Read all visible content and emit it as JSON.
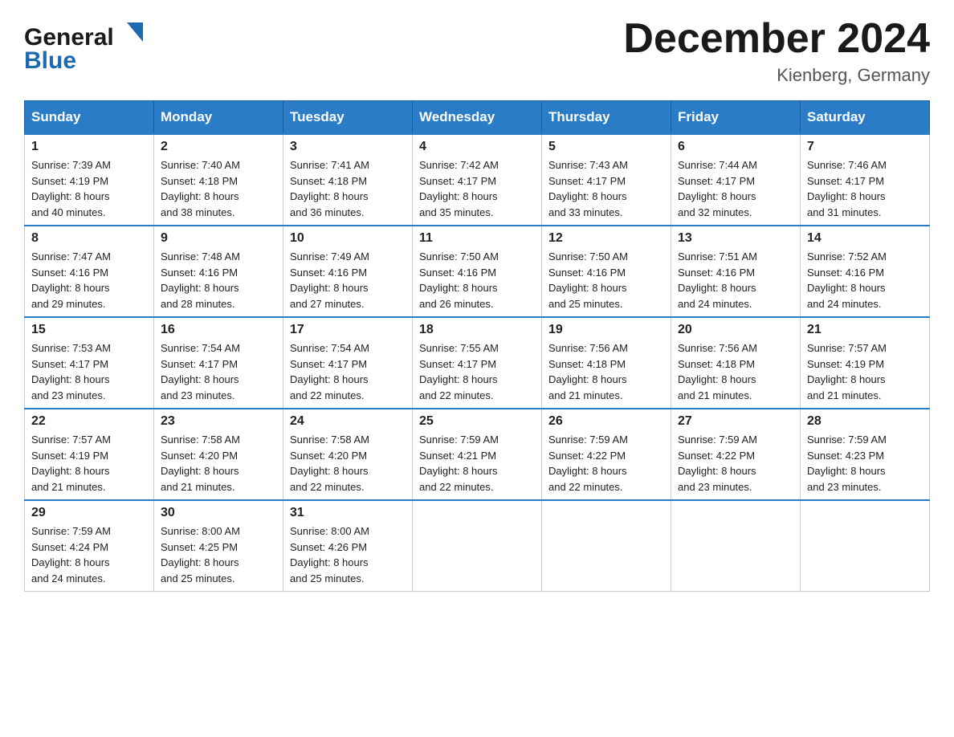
{
  "logo": {
    "text_general": "General",
    "text_blue": "Blue",
    "arrow_color": "#1e6ab0"
  },
  "header": {
    "title": "December 2024",
    "subtitle": "Kienberg, Germany"
  },
  "weekdays": [
    "Sunday",
    "Monday",
    "Tuesday",
    "Wednesday",
    "Thursday",
    "Friday",
    "Saturday"
  ],
  "weeks": [
    [
      {
        "day": "1",
        "sunrise": "7:39 AM",
        "sunset": "4:19 PM",
        "daylight": "8 hours and 40 minutes."
      },
      {
        "day": "2",
        "sunrise": "7:40 AM",
        "sunset": "4:18 PM",
        "daylight": "8 hours and 38 minutes."
      },
      {
        "day": "3",
        "sunrise": "7:41 AM",
        "sunset": "4:18 PM",
        "daylight": "8 hours and 36 minutes."
      },
      {
        "day": "4",
        "sunrise": "7:42 AM",
        "sunset": "4:17 PM",
        "daylight": "8 hours and 35 minutes."
      },
      {
        "day": "5",
        "sunrise": "7:43 AM",
        "sunset": "4:17 PM",
        "daylight": "8 hours and 33 minutes."
      },
      {
        "day": "6",
        "sunrise": "7:44 AM",
        "sunset": "4:17 PM",
        "daylight": "8 hours and 32 minutes."
      },
      {
        "day": "7",
        "sunrise": "7:46 AM",
        "sunset": "4:17 PM",
        "daylight": "8 hours and 31 minutes."
      }
    ],
    [
      {
        "day": "8",
        "sunrise": "7:47 AM",
        "sunset": "4:16 PM",
        "daylight": "8 hours and 29 minutes."
      },
      {
        "day": "9",
        "sunrise": "7:48 AM",
        "sunset": "4:16 PM",
        "daylight": "8 hours and 28 minutes."
      },
      {
        "day": "10",
        "sunrise": "7:49 AM",
        "sunset": "4:16 PM",
        "daylight": "8 hours and 27 minutes."
      },
      {
        "day": "11",
        "sunrise": "7:50 AM",
        "sunset": "4:16 PM",
        "daylight": "8 hours and 26 minutes."
      },
      {
        "day": "12",
        "sunrise": "7:50 AM",
        "sunset": "4:16 PM",
        "daylight": "8 hours and 25 minutes."
      },
      {
        "day": "13",
        "sunrise": "7:51 AM",
        "sunset": "4:16 PM",
        "daylight": "8 hours and 24 minutes."
      },
      {
        "day": "14",
        "sunrise": "7:52 AM",
        "sunset": "4:16 PM",
        "daylight": "8 hours and 24 minutes."
      }
    ],
    [
      {
        "day": "15",
        "sunrise": "7:53 AM",
        "sunset": "4:17 PM",
        "daylight": "8 hours and 23 minutes."
      },
      {
        "day": "16",
        "sunrise": "7:54 AM",
        "sunset": "4:17 PM",
        "daylight": "8 hours and 23 minutes."
      },
      {
        "day": "17",
        "sunrise": "7:54 AM",
        "sunset": "4:17 PM",
        "daylight": "8 hours and 22 minutes."
      },
      {
        "day": "18",
        "sunrise": "7:55 AM",
        "sunset": "4:17 PM",
        "daylight": "8 hours and 22 minutes."
      },
      {
        "day": "19",
        "sunrise": "7:56 AM",
        "sunset": "4:18 PM",
        "daylight": "8 hours and 21 minutes."
      },
      {
        "day": "20",
        "sunrise": "7:56 AM",
        "sunset": "4:18 PM",
        "daylight": "8 hours and 21 minutes."
      },
      {
        "day": "21",
        "sunrise": "7:57 AM",
        "sunset": "4:19 PM",
        "daylight": "8 hours and 21 minutes."
      }
    ],
    [
      {
        "day": "22",
        "sunrise": "7:57 AM",
        "sunset": "4:19 PM",
        "daylight": "8 hours and 21 minutes."
      },
      {
        "day": "23",
        "sunrise": "7:58 AM",
        "sunset": "4:20 PM",
        "daylight": "8 hours and 21 minutes."
      },
      {
        "day": "24",
        "sunrise": "7:58 AM",
        "sunset": "4:20 PM",
        "daylight": "8 hours and 22 minutes."
      },
      {
        "day": "25",
        "sunrise": "7:59 AM",
        "sunset": "4:21 PM",
        "daylight": "8 hours and 22 minutes."
      },
      {
        "day": "26",
        "sunrise": "7:59 AM",
        "sunset": "4:22 PM",
        "daylight": "8 hours and 22 minutes."
      },
      {
        "day": "27",
        "sunrise": "7:59 AM",
        "sunset": "4:22 PM",
        "daylight": "8 hours and 23 minutes."
      },
      {
        "day": "28",
        "sunrise": "7:59 AM",
        "sunset": "4:23 PM",
        "daylight": "8 hours and 23 minutes."
      }
    ],
    [
      {
        "day": "29",
        "sunrise": "7:59 AM",
        "sunset": "4:24 PM",
        "daylight": "8 hours and 24 minutes."
      },
      {
        "day": "30",
        "sunrise": "8:00 AM",
        "sunset": "4:25 PM",
        "daylight": "8 hours and 25 minutes."
      },
      {
        "day": "31",
        "sunrise": "8:00 AM",
        "sunset": "4:26 PM",
        "daylight": "8 hours and 25 minutes."
      },
      null,
      null,
      null,
      null
    ]
  ],
  "labels": {
    "sunrise": "Sunrise:",
    "sunset": "Sunset:",
    "daylight": "Daylight:"
  }
}
